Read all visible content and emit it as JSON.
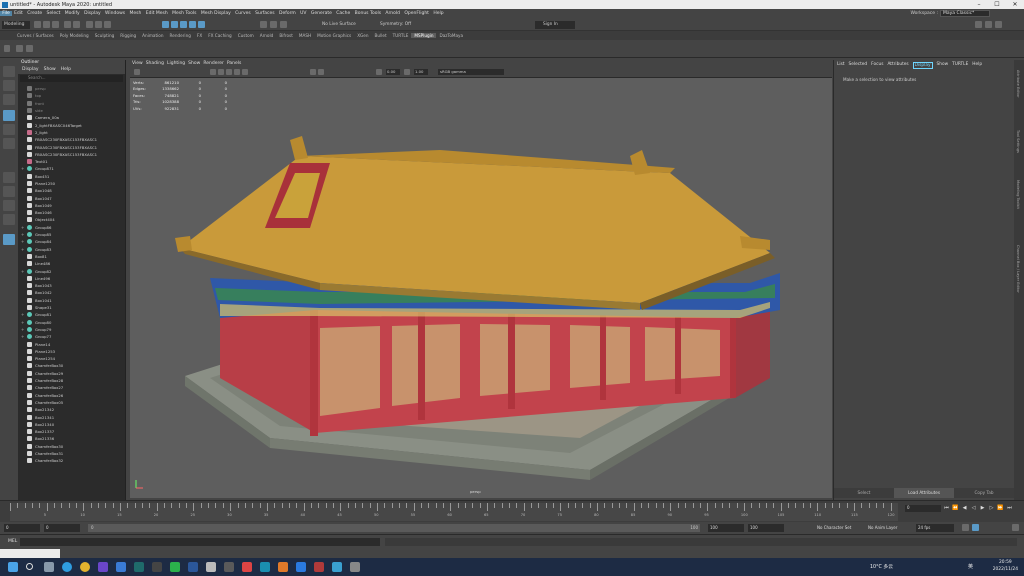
{
  "window": {
    "title": "untitled* - Autodesk Maya 2020: untitled",
    "app_icon": "maya-app-icon"
  },
  "menubar": {
    "items": [
      "File",
      "Edit",
      "Create",
      "Select",
      "Modify",
      "Display",
      "Windows",
      "Mesh",
      "Edit Mesh",
      "Mesh Tools",
      "Mesh Display",
      "Curves",
      "Surfaces",
      "Deform",
      "UV",
      "Generate",
      "Cache",
      "Bonus Tools",
      "Arnold",
      "OpenFlight",
      "Help"
    ],
    "active": "File",
    "workspace_label": "Workspace :",
    "workspace_value": "Maya Classic*"
  },
  "statusline": {
    "mode": "Modeling",
    "live_surface": "No Live Surface",
    "symmetry": "Symmetry: Off",
    "sign_in": "Sign In"
  },
  "shelf": {
    "tabs": [
      "Curves / Surfaces",
      "Poly Modeling",
      "Sculpting",
      "Rigging",
      "Animation",
      "Rendering",
      "FX",
      "FX Caching",
      "Custom",
      "Arnold",
      "Bifrost",
      "MASH",
      "Motion Graphics",
      "XGen",
      "Bullet",
      "TURTLE",
      "MSPlugin",
      "DazToMaya"
    ],
    "active": "MSPlugin"
  },
  "outliner": {
    "title": "Outliner",
    "menus": [
      "Display",
      "Show",
      "Help"
    ],
    "search_placeholder": "Search...",
    "items": [
      {
        "label": "persp",
        "icon": "dim",
        "dim": true,
        "expand": ""
      },
      {
        "label": "top",
        "icon": "dim",
        "dim": true,
        "expand": ""
      },
      {
        "label": "front",
        "icon": "dim",
        "dim": true,
        "expand": ""
      },
      {
        "label": "side",
        "icon": "dim",
        "dim": true,
        "expand": ""
      },
      {
        "label": "Camera_00a",
        "icon": "mesh",
        "dim": false,
        "expand": ""
      },
      {
        "label": "2_lightFBXASC046Target",
        "icon": "mesh",
        "dim": false,
        "expand": ""
      },
      {
        "label": "2_light",
        "icon": "light",
        "dim": false,
        "expand": ""
      },
      {
        "label": "FBXASC230FBXASC153FBXASC1",
        "icon": "mesh",
        "dim": false,
        "expand": ""
      },
      {
        "label": "FBXASC230FBXASC153FBXASC1",
        "icon": "mesh",
        "dim": false,
        "expand": ""
      },
      {
        "label": "FBXASC230FBXASC153FBXASC1",
        "icon": "mesh",
        "dim": false,
        "expand": ""
      },
      {
        "label": "Text01",
        "icon": "light",
        "dim": false,
        "expand": ""
      },
      {
        "label": "Group871",
        "icon": "group",
        "dim": false,
        "expand": "+"
      },
      {
        "label": "Box451",
        "icon": "mesh",
        "dim": false,
        "expand": ""
      },
      {
        "label": "Plane1250",
        "icon": "mesh",
        "dim": false,
        "expand": ""
      },
      {
        "label": "Box1048",
        "icon": "mesh",
        "dim": false,
        "expand": ""
      },
      {
        "label": "Box1047",
        "icon": "mesh",
        "dim": false,
        "expand": ""
      },
      {
        "label": "Box1049",
        "icon": "mesh",
        "dim": false,
        "expand": ""
      },
      {
        "label": "Box1046",
        "icon": "mesh",
        "dim": false,
        "expand": ""
      },
      {
        "label": "Object404",
        "icon": "mesh",
        "dim": false,
        "expand": ""
      },
      {
        "label": "Group86",
        "icon": "group",
        "dim": false,
        "expand": "+"
      },
      {
        "label": "Group85",
        "icon": "group",
        "dim": false,
        "expand": "+"
      },
      {
        "label": "Group84",
        "icon": "group",
        "dim": false,
        "expand": "+"
      },
      {
        "label": "Group83",
        "icon": "group",
        "dim": false,
        "expand": "+"
      },
      {
        "label": "Box81",
        "icon": "mesh",
        "dim": false,
        "expand": ""
      },
      {
        "label": "Line486",
        "icon": "mesh",
        "dim": false,
        "expand": ""
      },
      {
        "label": "Group82",
        "icon": "group",
        "dim": false,
        "expand": "+"
      },
      {
        "label": "Line496",
        "icon": "mesh",
        "dim": false,
        "expand": ""
      },
      {
        "label": "Box1043",
        "icon": "mesh",
        "dim": false,
        "expand": ""
      },
      {
        "label": "Box1042",
        "icon": "mesh",
        "dim": false,
        "expand": ""
      },
      {
        "label": "Box1041",
        "icon": "mesh",
        "dim": false,
        "expand": ""
      },
      {
        "label": "Shape31",
        "icon": "mesh",
        "dim": false,
        "expand": ""
      },
      {
        "label": "Group81",
        "icon": "group",
        "dim": false,
        "expand": "+"
      },
      {
        "label": "Group80",
        "icon": "group",
        "dim": false,
        "expand": "+"
      },
      {
        "label": "Group79",
        "icon": "group",
        "dim": false,
        "expand": "+"
      },
      {
        "label": "Group77",
        "icon": "group",
        "dim": false,
        "expand": "+"
      },
      {
        "label": "Plane14",
        "icon": "mesh",
        "dim": false,
        "expand": ""
      },
      {
        "label": "Plane1253",
        "icon": "mesh",
        "dim": false,
        "expand": ""
      },
      {
        "label": "Plane1254",
        "icon": "mesh",
        "dim": false,
        "expand": ""
      },
      {
        "label": "ChamferBox30",
        "icon": "mesh",
        "dim": false,
        "expand": ""
      },
      {
        "label": "ChamferBox29",
        "icon": "mesh",
        "dim": false,
        "expand": ""
      },
      {
        "label": "ChamferBox28",
        "icon": "mesh",
        "dim": false,
        "expand": ""
      },
      {
        "label": "ChamferBox27",
        "icon": "mesh",
        "dim": false,
        "expand": ""
      },
      {
        "label": "ChamferBox26",
        "icon": "mesh",
        "dim": false,
        "expand": ""
      },
      {
        "label": "ChamferBox05",
        "icon": "mesh",
        "dim": false,
        "expand": ""
      },
      {
        "label": "Box21342",
        "icon": "mesh",
        "dim": false,
        "expand": ""
      },
      {
        "label": "Box21341",
        "icon": "mesh",
        "dim": false,
        "expand": ""
      },
      {
        "label": "Box21340",
        "icon": "mesh",
        "dim": false,
        "expand": ""
      },
      {
        "label": "Box21337",
        "icon": "mesh",
        "dim": false,
        "expand": ""
      },
      {
        "label": "Box21336",
        "icon": "mesh",
        "dim": false,
        "expand": ""
      },
      {
        "label": "ChamferBox30",
        "icon": "mesh",
        "dim": false,
        "expand": ""
      },
      {
        "label": "ChamferBox31",
        "icon": "mesh",
        "dim": false,
        "expand": ""
      },
      {
        "label": "ChamferBox32",
        "icon": "mesh",
        "dim": false,
        "expand": ""
      }
    ]
  },
  "viewport": {
    "menus": [
      "View",
      "Shading",
      "Lighting",
      "Show",
      "Renderer",
      "Panels"
    ],
    "exposure": "0.00",
    "gamma": "1.00",
    "color_space": "sRGB gamma",
    "camera_label": "persp",
    "hud": [
      {
        "label": "Verts:",
        "v": "861210",
        "a": "0",
        "b": "0"
      },
      {
        "label": "Edges:",
        "v": "1338662",
        "a": "0",
        "b": "0"
      },
      {
        "label": "Faces:",
        "v": "748821",
        "a": "0",
        "b": "0"
      },
      {
        "label": "Tris:",
        "v": "1028388",
        "a": "0",
        "b": "0"
      },
      {
        "label": "UVs:",
        "v": "922831",
        "a": "0",
        "b": "0"
      }
    ]
  },
  "attribute_editor": {
    "menus": [
      "List",
      "Selected",
      "Focus",
      "Attributes",
      "Display",
      "Show",
      "TURTLE",
      "Help"
    ],
    "highlight": "Display",
    "message": "Make a selection to view attributes",
    "bottom": [
      "Select",
      "Load Attributes",
      "Copy Tab"
    ],
    "side_tabs": [
      "Attribute Editor",
      "Tool Settings",
      "Modeling Toolkit",
      "Channel Box / Layer Editor"
    ]
  },
  "timeline": {
    "ticks": [
      "5",
      "10",
      "15",
      "20",
      "25",
      "30",
      "35",
      "40",
      "45",
      "50",
      "55",
      "60",
      "65",
      "70",
      "75",
      "80",
      "85",
      "90",
      "95",
      "100",
      "105",
      "110",
      "115",
      "120"
    ],
    "current_frame": "0"
  },
  "range": {
    "start": "0",
    "start2": "0",
    "slider_label": "0",
    "end": "100",
    "end2": "100",
    "end3": "100",
    "character_set": "No Character Set",
    "anim_layer": "No Anim Layer",
    "fps": "24 fps"
  },
  "command_line": {
    "label": "MEL"
  },
  "taskbar": {
    "weather": "10°C",
    "weather_text": "多云",
    "time": "20:59",
    "date": "2022/11/24",
    "ime": "英"
  },
  "colors": {
    "accent": "#5285a6",
    "roof": "#c99a3a",
    "wall": "#c0424a",
    "taskbar": "#1d2b44"
  }
}
